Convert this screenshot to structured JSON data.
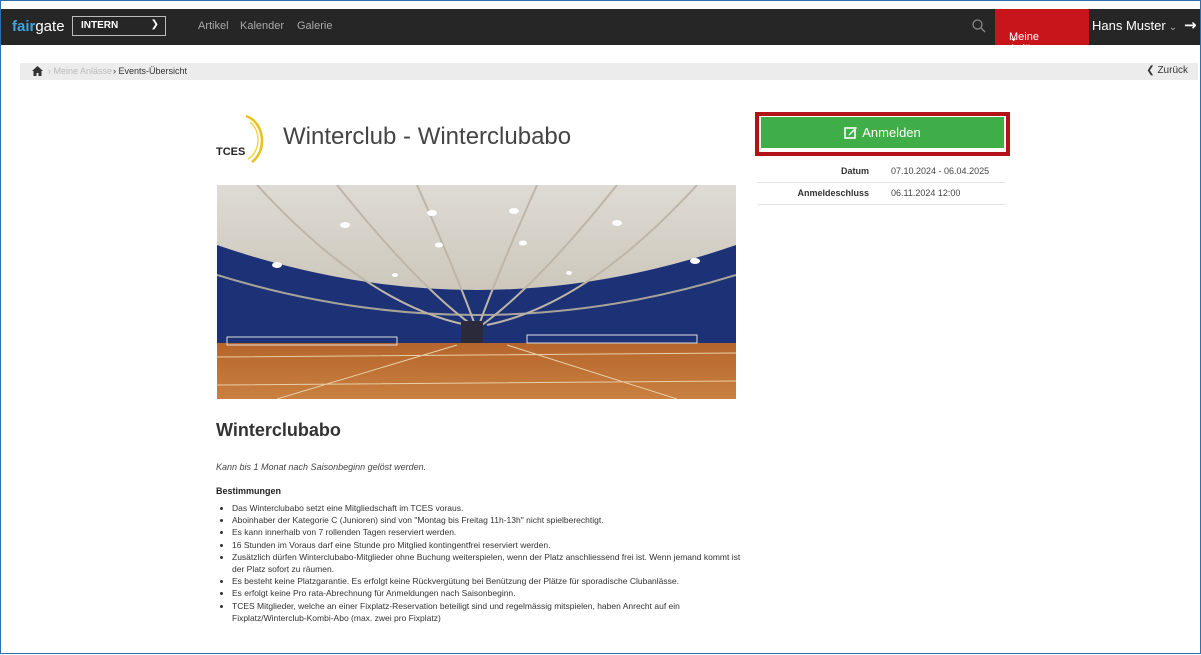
{
  "header": {
    "logo_fair": "fair",
    "logo_gate": "gate",
    "select_value": "INTERN",
    "nav": [
      "Artikel",
      "Kalender",
      "Galerie"
    ],
    "meine_label": "Meine Anlässe",
    "user_name": "Hans Muster",
    "colors": {
      "bar": "#262626",
      "accent_red": "#c8151c",
      "brand_blue": "#3da5e0"
    }
  },
  "breadcrumb": {
    "items": [
      "Meine Anlässe",
      "Events-Übersicht"
    ],
    "back_label": "Zurück"
  },
  "event": {
    "logo_text": "TCES",
    "title": "Winterclub - Winterclubabo",
    "heading": "Winterclubabo",
    "intro": "Kann bis 1 Monat nach Saisonbeginn gelöst werden.",
    "rules_heading": "Bestimmungen",
    "rules": [
      "Das Winterclubabo setzt eine Mitgliedschaft im TCES voraus.",
      "Aboinhaber der Kategorie C (Junioren) sind von \"Montag bis Freitag 11h-13h\" nicht spielberechtigt.",
      "Es kann innerhalb von 7 rollenden Tagen reserviert werden.",
      "16 Stunden im Voraus darf eine Stunde pro Mitglied kontingentfrei reserviert werden.",
      "Zusätzlich dürfen Winterclubabo-Mitglieder ohne Buchung weiterspielen, wenn der Platz anschliessend frei ist. Wenn jemand kommt ist der Platz sofort zu räumen.",
      "Es besteht keine Platzgarantie. Es erfolgt keine Rückvergütung bei Benützung der Plätze für sporadische Clubanlässe.",
      "Es erfolgt keine Pro rata-Abrechnung für Anmeldungen nach Saisonbeginn.",
      "TCES Mitglieder, welche an einer Fixplatz-Reservation beteiligt sind und regelmässig mitspielen, haben Anrecht auf ein Fixplatz/Winterclub-Kombi-Abo (max. zwei pro Fixplatz)"
    ]
  },
  "sidebar": {
    "register_label": "Anmelden",
    "register_color": "#3fae49",
    "rows": [
      {
        "key": "Datum",
        "value": "07.10.2024 - 06.04.2025"
      },
      {
        "key": "Anmeldeschluss",
        "value": "06.11.2024 12:00"
      }
    ]
  }
}
